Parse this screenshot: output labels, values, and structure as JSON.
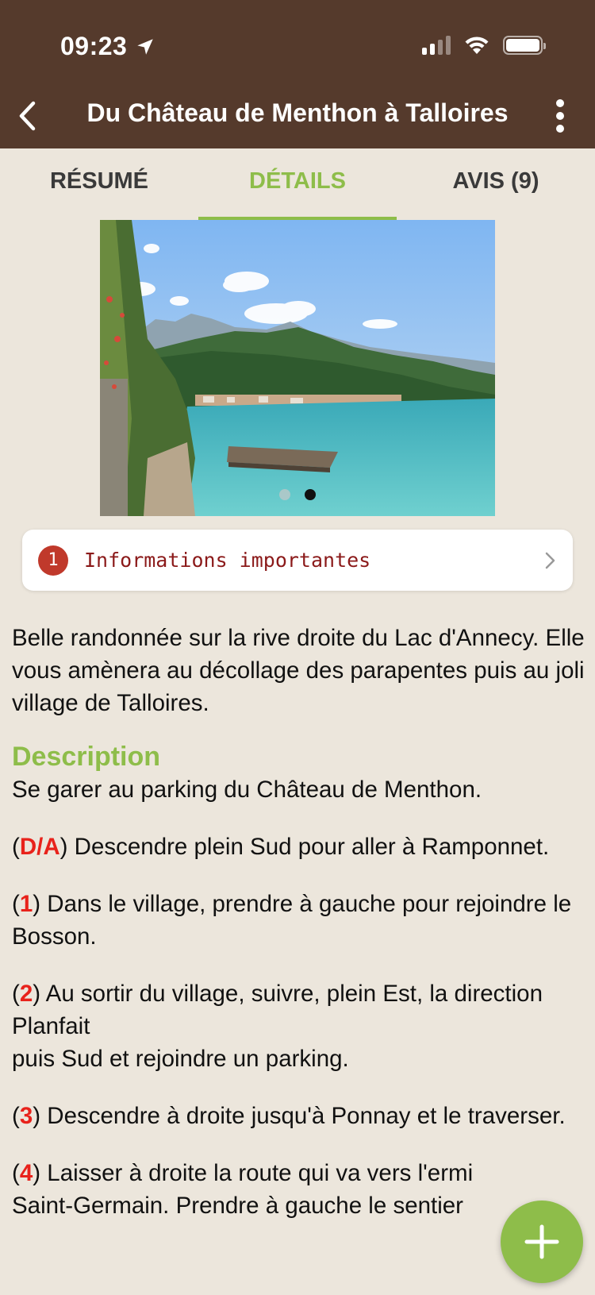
{
  "status_bar": {
    "time": "09:23"
  },
  "nav": {
    "title": "Du Château de Menthon à Talloires"
  },
  "tabs": [
    {
      "label": "RÉSUMÉ",
      "active": false
    },
    {
      "label": "DÉTAILS",
      "active": true
    },
    {
      "label": "AVIS (9)",
      "active": false
    }
  ],
  "carousel": {
    "image_count": 2,
    "active_index": 1
  },
  "info_card": {
    "badge": "1",
    "label": "Informations importantes"
  },
  "intro": "Belle randonnée sur la rive droite du Lac d'Annecy. Elle vous amènera au décollage des parapentes puis au joli village de Talloires.",
  "description": {
    "title": "Description",
    "first_line": "Se garer au parking du Château de Menthon.",
    "steps": [
      {
        "num": "D/A",
        "text": "Descendre plein Sud pour aller à Ramponnet."
      },
      {
        "num": "1",
        "text": "Dans le village, prendre à gauche pour rejoindre le Bosson."
      },
      {
        "num": "2",
        "text": "Au sortir du village, suivre, plein Est, la direction Planfait"
      },
      {
        "num": "3",
        "text": "Descendre à droite jusqu'à Ponnay et le traverser."
      },
      {
        "num": "4",
        "text": "Laisser à droite la route qui va vers l'ermi"
      }
    ],
    "step2_extra": "puis Sud et rejoindre un parking.",
    "step4_extra": "Saint-Germain. Prendre à gauche le sentier"
  },
  "colors": {
    "header_bg": "#553a2c",
    "accent_green": "#8ebd4a",
    "step_red": "#e8221b",
    "page_bg": "#ece6dc"
  }
}
